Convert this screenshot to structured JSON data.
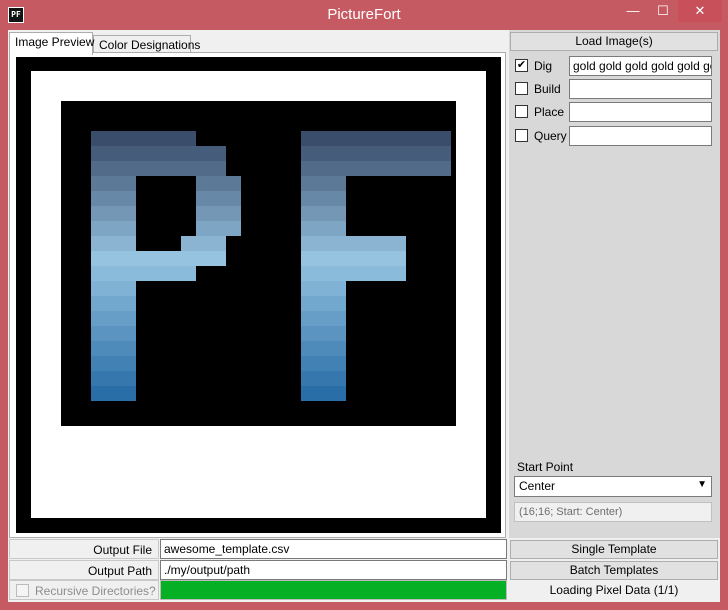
{
  "window": {
    "title": "PictureFort",
    "icon_text": "PF",
    "minimize_glyph": "—",
    "maximize_glyph": "☐",
    "close_glyph": "✕"
  },
  "tabs": [
    {
      "label": "Image Preview",
      "active": true
    },
    {
      "label": "Color Designations",
      "active": false
    }
  ],
  "preview": {
    "letters": "PF",
    "accent": "#3f78a8"
  },
  "sidebar": {
    "load_button": "Load Image(s)",
    "designations": [
      {
        "label": "Dig",
        "checked": true,
        "value": "gold gold gold gold gold gold"
      },
      {
        "label": "Build",
        "checked": false,
        "value": ""
      },
      {
        "label": "Place",
        "checked": false,
        "value": ""
      },
      {
        "label": "Query",
        "checked": false,
        "value": ""
      }
    ],
    "start_point_label": "Start Point",
    "start_point_value": "Center",
    "start_point_info": "(16;16; Start: Center)"
  },
  "output": {
    "file_label": "Output File",
    "file_value": "awesome_template.csv",
    "path_label": "Output Path",
    "path_value": "./my/output/path",
    "single_button": "Single Template",
    "batch_button": "Batch Templates",
    "recursive_label": "Recursive Directories?",
    "recursive_checked": false,
    "progress_percent": 100,
    "status": "Loading Pixel Data (1/1)"
  }
}
